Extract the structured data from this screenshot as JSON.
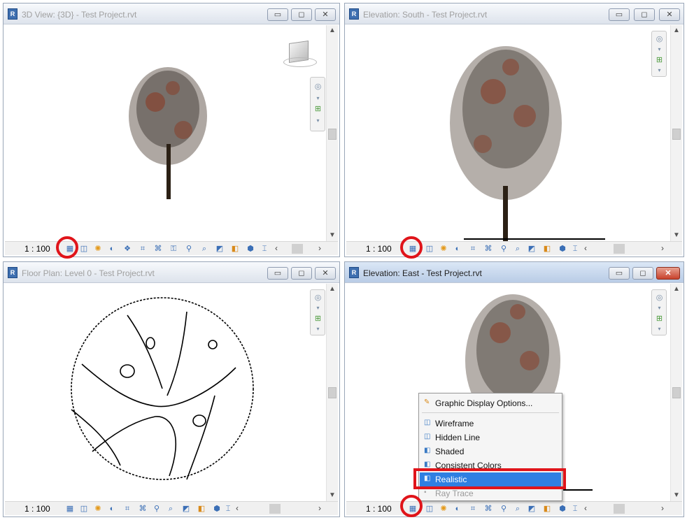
{
  "colors": {
    "highlight": "#e0141a",
    "menu_selected": "#2f7fe2",
    "tree_trunk": "#2b2015",
    "leaf_red": "#9c3a22"
  },
  "windows": [
    {
      "title": "3D View: {3D} - Test Project.rvt",
      "scale": "1 : 100",
      "active": false
    },
    {
      "title": "Elevation: South - Test Project.rvt",
      "scale": "1 : 100",
      "active": false
    },
    {
      "title": "Floor Plan: Level 0 - Test Project.rvt",
      "scale": "1 : 100",
      "active": false
    },
    {
      "title": "Elevation: East - Test Project.rvt",
      "scale": "1 : 100",
      "active": true
    }
  ],
  "window_buttons": {
    "minimize": "▭",
    "maximize": "◻",
    "close": "✕"
  },
  "view_cube": {
    "icon": "view-cube-icon"
  },
  "context_menu": {
    "graphic_display": "Graphic Display Options...",
    "items": [
      "Wireframe",
      "Hidden Line",
      "Shaded",
      "Consistent Colors",
      "Realistic",
      "Ray Trace"
    ],
    "selected": "Realistic",
    "disabled": "Ray Trace"
  },
  "statusbar_icons": [
    "visual-style-icon",
    "detail-level-icon",
    "sun-path-icon",
    "shadows-icon",
    "crop-icon",
    "show-crop-icon",
    "temporary-hide-icon",
    "reveal-hidden-icon",
    "lock-view-icon",
    "analysis-icon",
    "highlight-icon"
  ]
}
